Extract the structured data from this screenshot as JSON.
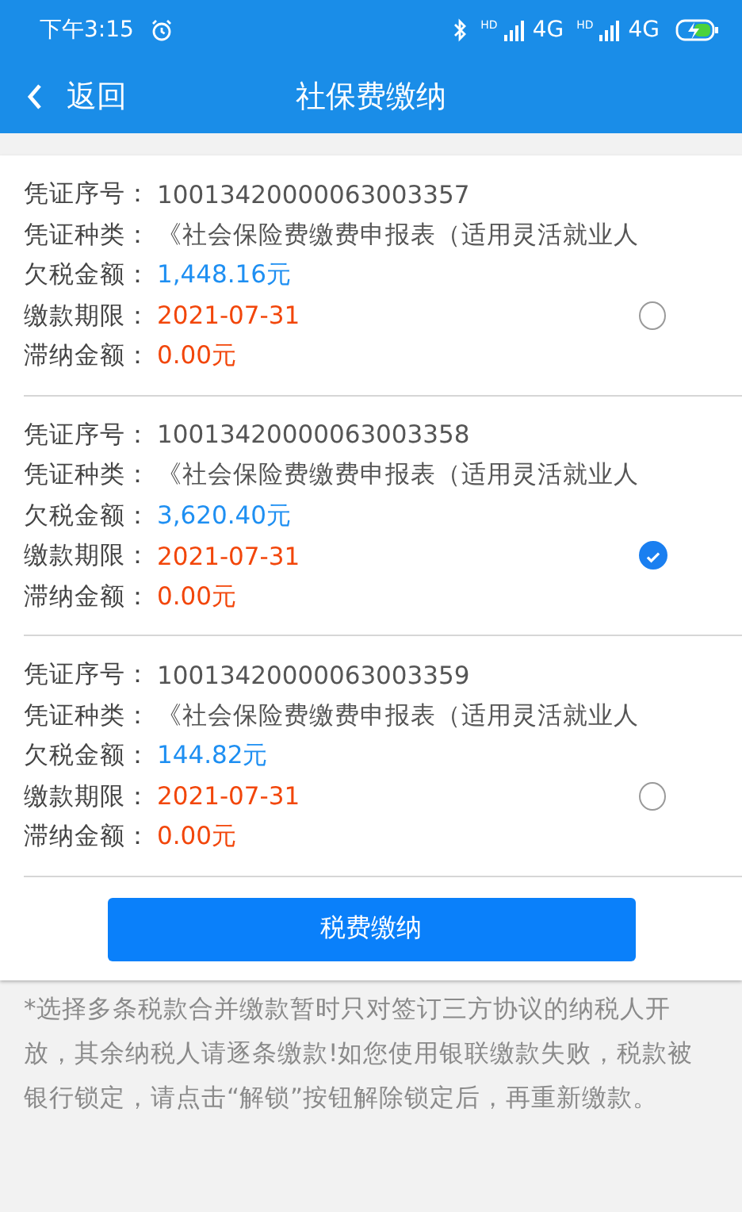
{
  "status_bar": {
    "time": "下午3:15",
    "signals": [
      {
        "badge": "HD",
        "network": "4G"
      },
      {
        "badge": "HD",
        "network": "4G"
      }
    ]
  },
  "header": {
    "back": "返回",
    "title": "社保费缴纳"
  },
  "records": [
    {
      "selected": false,
      "fields": [
        {
          "label": "凭证序号：",
          "value": "10013420000063003357",
          "kind": "plain"
        },
        {
          "label": "凭证种类：",
          "value": "《社会保险费缴费申报表（适用灵活就业人",
          "kind": "plain"
        },
        {
          "label": "欠税金额：",
          "value": "1,448.16元",
          "kind": "amount"
        },
        {
          "label": "缴款期限：",
          "value": "2021-07-31",
          "kind": "alert"
        },
        {
          "label": "滞纳金额：",
          "value": "0.00元",
          "kind": "alert"
        }
      ]
    },
    {
      "selected": true,
      "fields": [
        {
          "label": "凭证序号：",
          "value": "10013420000063003358",
          "kind": "plain"
        },
        {
          "label": "凭证种类：",
          "value": "《社会保险费缴费申报表（适用灵活就业人",
          "kind": "plain"
        },
        {
          "label": "欠税金额：",
          "value": "3,620.40元",
          "kind": "amount"
        },
        {
          "label": "缴款期限：",
          "value": "2021-07-31",
          "kind": "alert"
        },
        {
          "label": "滞纳金额：",
          "value": "0.00元",
          "kind": "alert"
        }
      ]
    },
    {
      "selected": false,
      "fields": [
        {
          "label": "凭证序号：",
          "value": "10013420000063003359",
          "kind": "plain"
        },
        {
          "label": "凭证种类：",
          "value": "《社会保险费缴费申报表（适用灵活就业人",
          "kind": "plain"
        },
        {
          "label": "欠税金额：",
          "value": "144.82元",
          "kind": "amount"
        },
        {
          "label": "缴款期限：",
          "value": "2021-07-31",
          "kind": "alert"
        },
        {
          "label": "滞纳金额：",
          "value": "0.00元",
          "kind": "alert"
        }
      ]
    }
  ],
  "pay_button": "税费缴纳",
  "note": "*选择多条税款合并缴款暂时只对签订三方协议的纳税人开放，其余纳税人请逐条缴款!如您使用银联缴款失败，税款被银行锁定，请点击“解锁”按钮解除锁定后，再重新缴款。"
}
